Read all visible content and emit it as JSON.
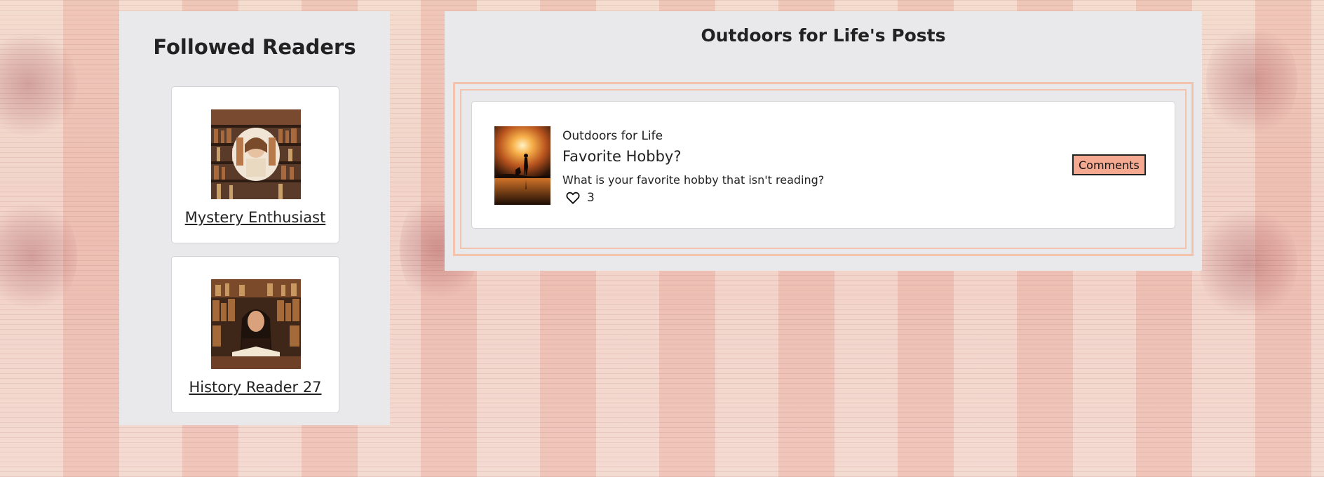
{
  "followed": {
    "title": "Followed Readers",
    "readers": [
      {
        "name": "Mystery Enthusiast",
        "avatar_icon": "reader-photo-bookshelf"
      },
      {
        "name": "History Reader 27",
        "avatar_icon": "reader-photo-library"
      }
    ]
  },
  "posts": {
    "title": "Outdoors for Life's Posts",
    "items": [
      {
        "author": "Outdoors for Life",
        "title": "Favorite Hobby?",
        "body": "What is your favorite hobby that isn't reading?",
        "likes": "3",
        "comments_label": "Comments",
        "thumb_icon": "sunset-silhouette-photo"
      }
    ]
  },
  "colors": {
    "panel": "#e9e9ec",
    "accent_border": "#f4c3ae",
    "button": "#f4a990"
  }
}
